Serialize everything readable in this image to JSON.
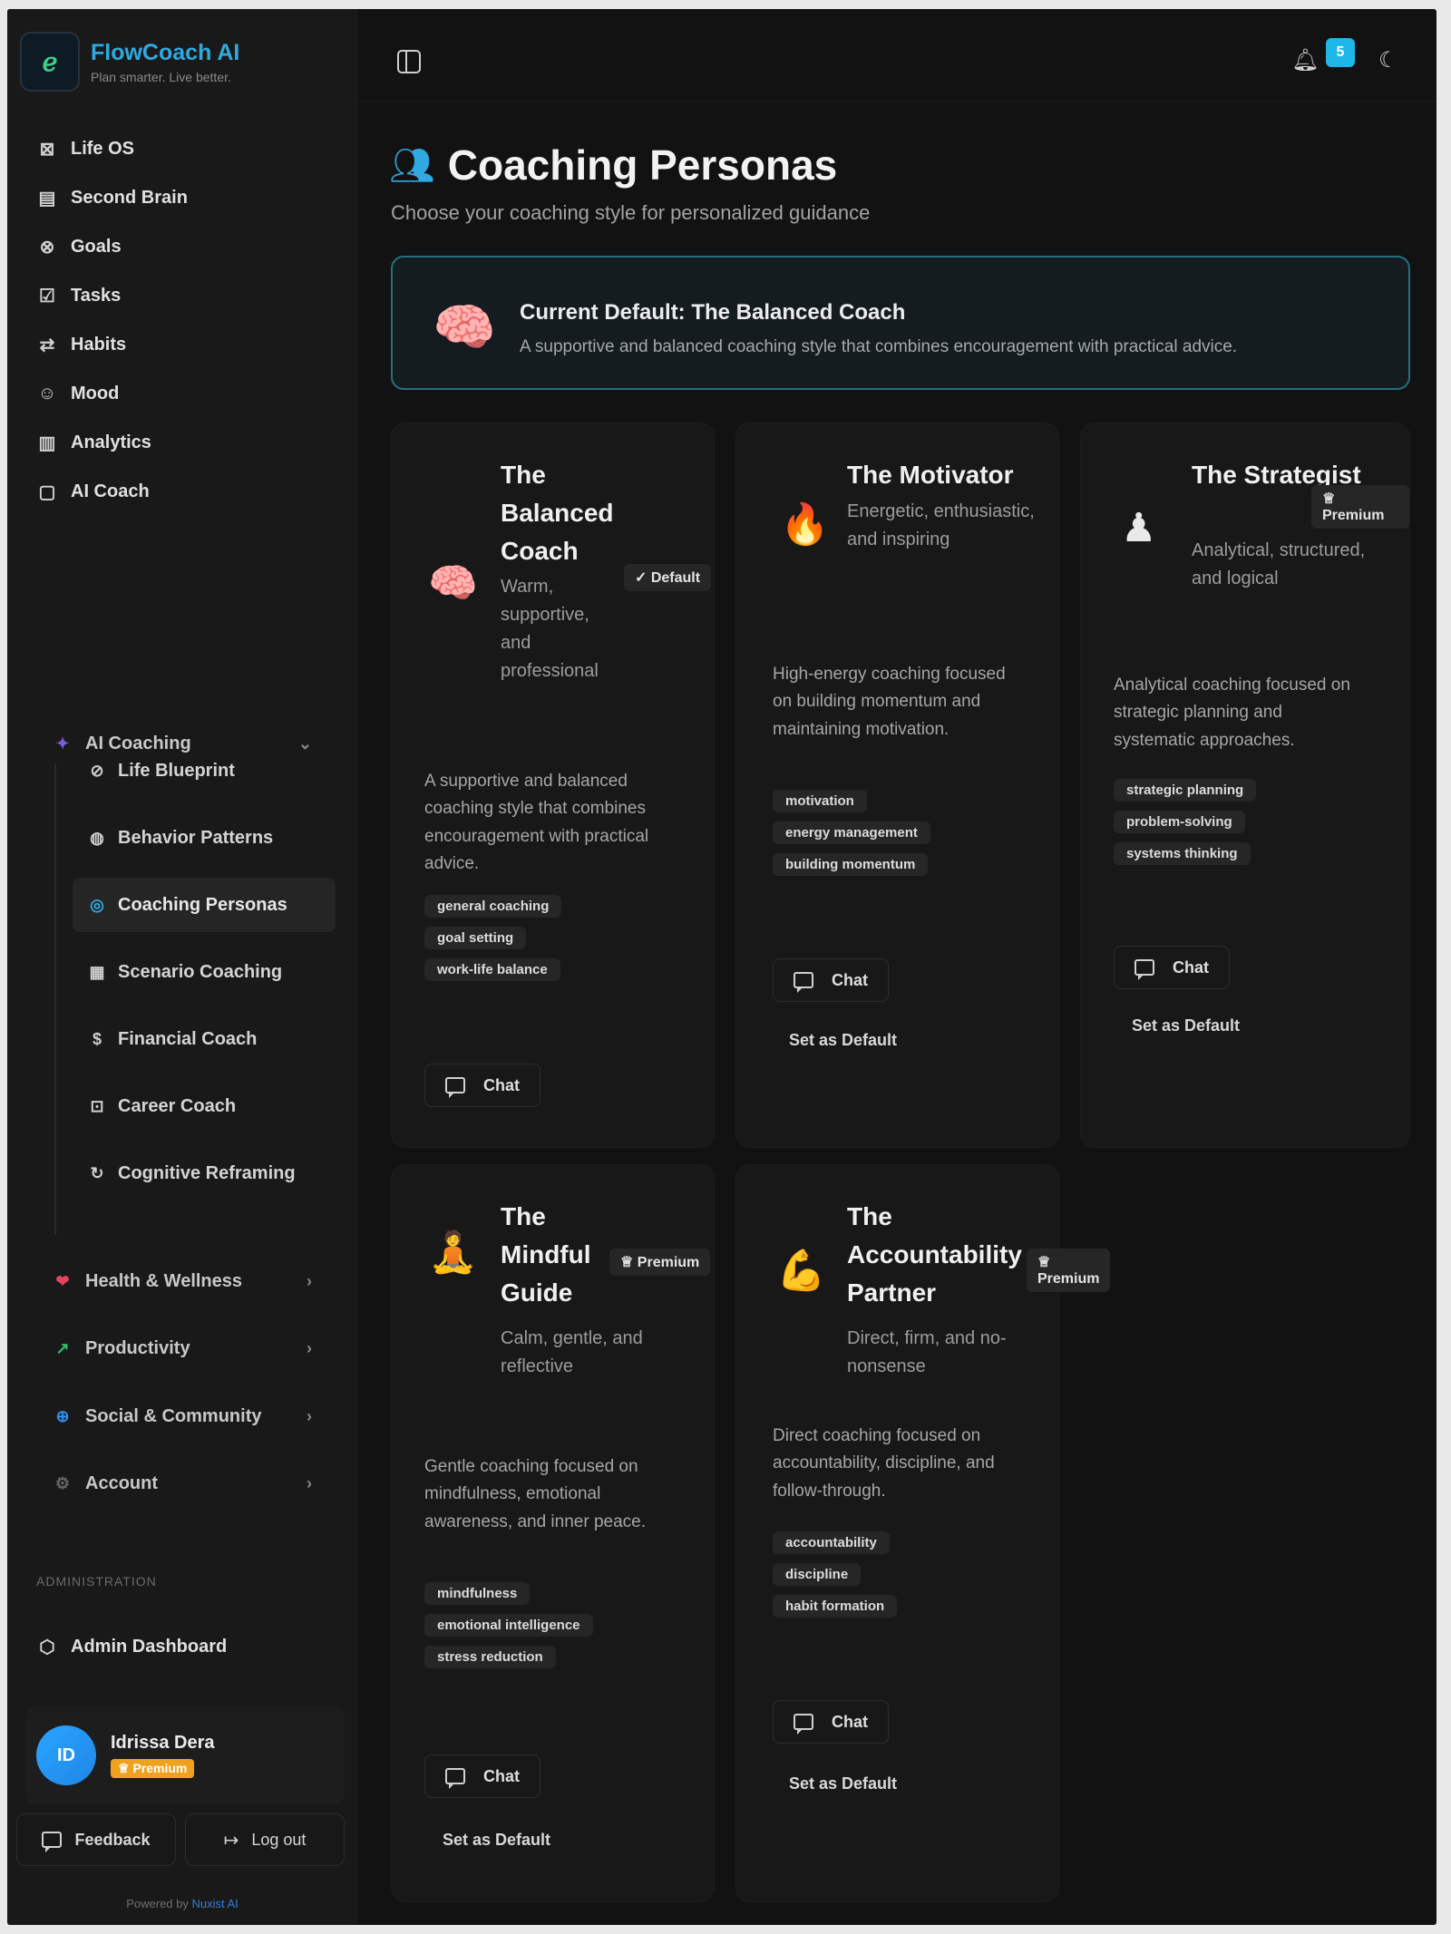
{
  "app": {
    "name": "FlowCoach AI",
    "tagline": "Plan smarter. Live better.",
    "logo_glyph": "ℯ"
  },
  "sidebar": {
    "main_items": [
      {
        "label": "Life OS",
        "icon": "grid-icon",
        "glyph": "⊠"
      },
      {
        "label": "Second Brain",
        "icon": "document-icon",
        "glyph": "▤"
      },
      {
        "label": "Goals",
        "icon": "target-icon",
        "glyph": "⊗"
      },
      {
        "label": "Tasks",
        "icon": "checkbox-icon",
        "glyph": "☑"
      },
      {
        "label": "Habits",
        "icon": "repeat-icon",
        "glyph": "⇄"
      },
      {
        "label": "Mood",
        "icon": "smile-icon",
        "glyph": "☺"
      },
      {
        "label": "Analytics",
        "icon": "bar-chart-icon",
        "glyph": "▥"
      },
      {
        "label": "AI Coach",
        "icon": "message-icon",
        "glyph": "▢"
      }
    ],
    "ai_coaching": {
      "label": "AI Coaching",
      "glyph": "✦",
      "items": [
        {
          "label": "Life Blueprint",
          "icon": "compass-icon",
          "glyph": "⊘"
        },
        {
          "label": "Behavior Patterns",
          "icon": "brain-icon",
          "glyph": "◍"
        },
        {
          "label": "Coaching Personas",
          "icon": "users-icon",
          "glyph": "◎"
        },
        {
          "label": "Scenario Coaching",
          "icon": "film-icon",
          "glyph": "▦"
        },
        {
          "label": "Financial Coach",
          "icon": "dollar-icon",
          "glyph": "$"
        },
        {
          "label": "Career Coach",
          "icon": "briefcase-icon",
          "glyph": "⊡"
        },
        {
          "label": "Cognitive Reframing",
          "icon": "refresh-icon",
          "glyph": "↻"
        }
      ]
    },
    "groups": [
      {
        "label": "Health & Wellness",
        "icon": "heart-icon",
        "glyph": "❤",
        "color": "#e0455a"
      },
      {
        "label": "Productivity",
        "icon": "trending-up-icon",
        "glyph": "↗",
        "color": "#2fbf71"
      },
      {
        "label": "Social & Community",
        "icon": "globe-icon",
        "glyph": "⊕",
        "color": "#2f8fe8"
      },
      {
        "label": "Account",
        "icon": "settings-icon",
        "glyph": "⚙",
        "color": "#666666"
      }
    ],
    "admin_label": "ADMINISTRATION",
    "admin_item": {
      "label": "Admin Dashboard",
      "icon": "shield-icon",
      "glyph": "⬡"
    },
    "user": {
      "initials": "ID",
      "name": "Idrissa Dera",
      "plan": "♕ Premium"
    },
    "feedback_label": "Feedback",
    "logout_label": "Log out",
    "powered_prefix": "Powered by ",
    "powered_brand": "Nuxist AI"
  },
  "topbar": {
    "badge": "5",
    "bell_glyph": "♫",
    "theme_glyph": "☾"
  },
  "page": {
    "title": "Coaching Personas",
    "subtitle": "Choose your coaching style for personalized guidance",
    "current": {
      "title": "Current Default: The Balanced Coach",
      "description": "A supportive and balanced coaching style that combines encouragement with practical advice.",
      "emoji": "🧠"
    }
  },
  "personas": [
    {
      "emoji": "🧠",
      "title": "The Balanced Coach",
      "badge": "✓ Default",
      "tagline": "Warm, supportive, and professional",
      "description": "A supportive and balanced coaching style that combines encouragement with practical advice.",
      "tags": [
        "general coaching",
        "goal setting",
        "work-life balance"
      ],
      "chat": "Chat",
      "set_default": ""
    },
    {
      "emoji": "🔥",
      "title": "The Motivator",
      "badge": "",
      "tagline": "Energetic, enthusiastic, and inspiring",
      "description": "High-energy coaching focused on building momentum and maintaining motivation.",
      "tags": [
        "motivation",
        "energy management",
        "building momentum"
      ],
      "chat": "Chat",
      "set_default": "Set as Default"
    },
    {
      "emoji": "♟",
      "title": "The Strategist",
      "badge": "♕ Premium",
      "tagline": "Analytical, structured, and logical",
      "description": "Analytical coaching focused on strategic planning and systematic approaches.",
      "tags": [
        "strategic planning",
        "problem-solving",
        "systems thinking"
      ],
      "chat": "Chat",
      "set_default": "Set as Default"
    },
    {
      "emoji": "🧘",
      "title": "The Mindful Guide",
      "badge": "♕ Premium",
      "tagline": "Calm, gentle, and reflective",
      "description": "Gentle coaching focused on mindfulness, emotional awareness, and inner peace.",
      "tags": [
        "mindfulness",
        "emotional intelligence",
        "stress reduction"
      ],
      "chat": "Chat",
      "set_default": "Set as Default"
    },
    {
      "emoji": "💪",
      "title": "The Accountability Partner",
      "badge": "♕ Premium",
      "tagline": "Direct, firm, and no-nonsense",
      "description": "Direct coaching focused on accountability, discipline, and follow-through.",
      "tags": [
        "accountability",
        "discipline",
        "habit formation"
      ],
      "chat": "Chat",
      "set_default": "Set as Default"
    }
  ]
}
